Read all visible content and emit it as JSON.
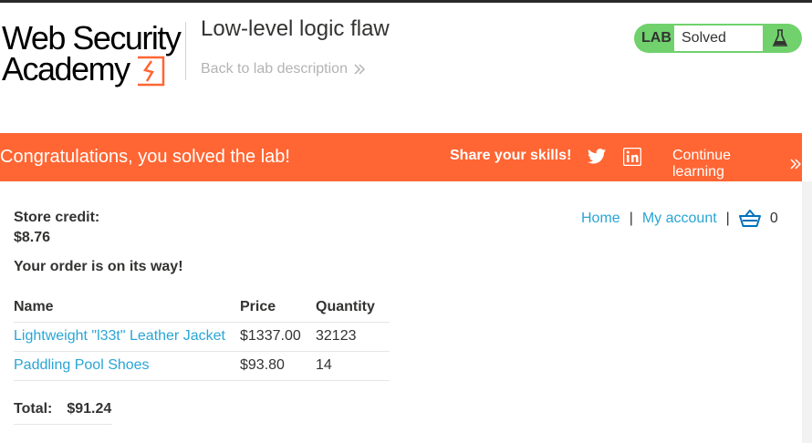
{
  "header": {
    "logo_line1": "Web Security",
    "logo_line2": "Academy",
    "lab_title": "Low-level logic flaw",
    "back_link": "Back to lab description",
    "status_badge_label": "LAB",
    "status_value": "Solved",
    "status_color": "#70d16d"
  },
  "banner": {
    "congrats_text": "Congratulations, you solved the lab!",
    "share_text": "Share your skills!",
    "continue_text": "Continue learning",
    "bg_color": "#ff6633",
    "icons": [
      "twitter-icon",
      "linkedin-icon",
      "double-chevron-icon"
    ]
  },
  "account": {
    "store_credit_label": "Store credit:",
    "store_credit_value": "$8.76",
    "order_message": "Your order is on its way!"
  },
  "nav": {
    "home": "Home",
    "separator": "|",
    "my_account": "My account",
    "cart_count": "0"
  },
  "order_table": {
    "headers": [
      "Name",
      "Price",
      "Quantity"
    ],
    "rows": [
      {
        "name": "Lightweight \"l33t\" Leather Jacket",
        "price": "$1337.00",
        "quantity": "32123"
      },
      {
        "name": "Paddling Pool Shoes",
        "price": "$93.80",
        "quantity": "14"
      }
    ]
  },
  "total": {
    "label": "Total:",
    "value": "$91.24"
  }
}
